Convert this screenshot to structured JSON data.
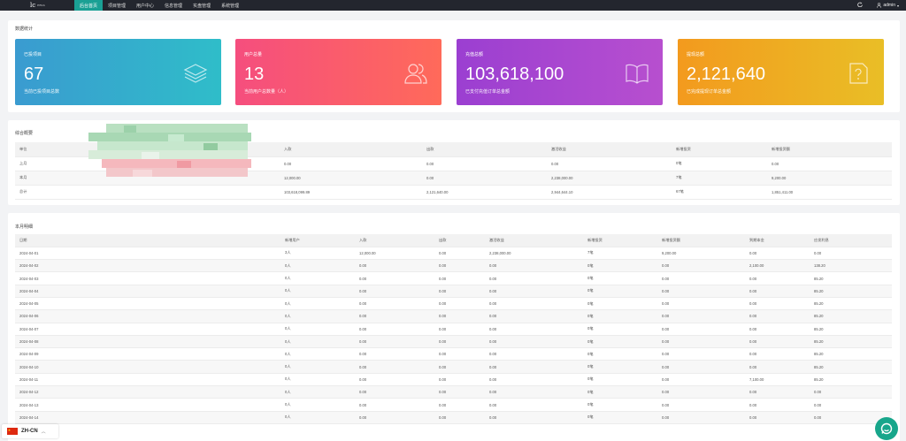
{
  "header": {
    "logo_mark": "lc",
    "logo_sub": "ERLS",
    "nav": [
      "后台首页",
      "项目管理",
      "用户中心",
      "信息管理",
      "实盘管理",
      "系统管理"
    ],
    "user": "admin",
    "refresh_icon": "refresh-icon",
    "user_icon": "user-icon"
  },
  "stats": {
    "title": "数据统计",
    "cards": [
      {
        "label": "已投项目",
        "value": "67",
        "desc": "当前已投项目总数",
        "icon": "layers-icon",
        "color_from": "#3a9bd0",
        "color_to": "#2fbdc9"
      },
      {
        "label": "用户总量",
        "value": "13",
        "desc": "当前用户总数量（人）",
        "icon": "users-icon",
        "color_from": "#f54e7e",
        "color_to": "#ff6a5a"
      },
      {
        "label": "充值总额",
        "value": "103,618,100",
        "desc": "已支付充值订单总金额",
        "icon": "book-icon",
        "color_from": "#9b3fd1",
        "color_to": "#b74fcf"
      },
      {
        "label": "提现总额",
        "value": "2,121,640",
        "desc": "已完成提现订单总金额",
        "icon": "help-doc-icon",
        "color_from": "#f39a1e",
        "color_to": "#e9be26"
      }
    ]
  },
  "overview": {
    "title": "综合概要",
    "headers": [
      "单位",
      "",
      "入款",
      "出款",
      "激活收益",
      "新增投资",
      "新增投资额"
    ],
    "rows": [
      [
        "上月",
        "",
        "0.00",
        "0.00",
        "0.00",
        "0笔",
        "0.00"
      ],
      [
        "本月",
        "",
        "12,000.00",
        "0.00",
        "2,238,000.00",
        "7笔",
        "9,200.00"
      ],
      [
        "总计",
        "",
        "103,618,099.89",
        "2,121,640.00",
        "2,944,644.10",
        "67笔",
        "1,851,411.00"
      ]
    ]
  },
  "monthly": {
    "title": "本月明细",
    "headers": [
      "日期",
      "新增用户",
      "入款",
      "出款",
      "激活收益",
      "新增投资",
      "新增投资额",
      "到期本金",
      "应发利息"
    ],
    "rows": [
      [
        "2024-04-01",
        "3人",
        "12,000.00",
        "0.00",
        "2,238,000.00",
        "7笔",
        "9,200.00",
        "0.00",
        "0.00"
      ],
      [
        "2024-04-02",
        "0人",
        "0.00",
        "0.00",
        "0.00",
        "0笔",
        "0.00",
        "2,100.00",
        "138.20"
      ],
      [
        "2024-04-03",
        "0人",
        "0.00",
        "0.00",
        "0.00",
        "0笔",
        "0.00",
        "0.00",
        "85.20"
      ],
      [
        "2024-04-04",
        "0人",
        "0.00",
        "0.00",
        "0.00",
        "0笔",
        "0.00",
        "0.00",
        "85.20"
      ],
      [
        "2024-04-05",
        "0人",
        "0.00",
        "0.00",
        "0.00",
        "0笔",
        "0.00",
        "0.00",
        "85.20"
      ],
      [
        "2024-04-06",
        "0人",
        "0.00",
        "0.00",
        "0.00",
        "0笔",
        "0.00",
        "0.00",
        "85.20"
      ],
      [
        "2024-04-07",
        "0人",
        "0.00",
        "0.00",
        "0.00",
        "0笔",
        "0.00",
        "0.00",
        "85.20"
      ],
      [
        "2024-04-08",
        "0人",
        "0.00",
        "0.00",
        "0.00",
        "0笔",
        "0.00",
        "0.00",
        "85.20"
      ],
      [
        "2024-04-09",
        "0人",
        "0.00",
        "0.00",
        "0.00",
        "0笔",
        "0.00",
        "0.00",
        "85.20"
      ],
      [
        "2024-04-10",
        "0人",
        "0.00",
        "0.00",
        "0.00",
        "0笔",
        "0.00",
        "0.00",
        "85.20"
      ],
      [
        "2024-04-11",
        "0人",
        "0.00",
        "0.00",
        "0.00",
        "0笔",
        "0.00",
        "7,100.00",
        "85.20"
      ],
      [
        "2024-04-12",
        "0人",
        "0.00",
        "0.00",
        "0.00",
        "0笔",
        "0.00",
        "0.00",
        "0.00"
      ],
      [
        "2024-04-13",
        "0人",
        "0.00",
        "0.00",
        "0.00",
        "0笔",
        "0.00",
        "0.00",
        "0.00"
      ],
      [
        "2024-04-14",
        "0人",
        "0.00",
        "0.00",
        "0.00",
        "0笔",
        "0.00",
        "0.00",
        "0.00"
      ]
    ]
  },
  "language": {
    "label": "ZH-CN",
    "flag_icon": "china-flag-icon",
    "chevron_icon": "chevron-up-icon"
  },
  "chat_icon": "chat-bubble-icon"
}
